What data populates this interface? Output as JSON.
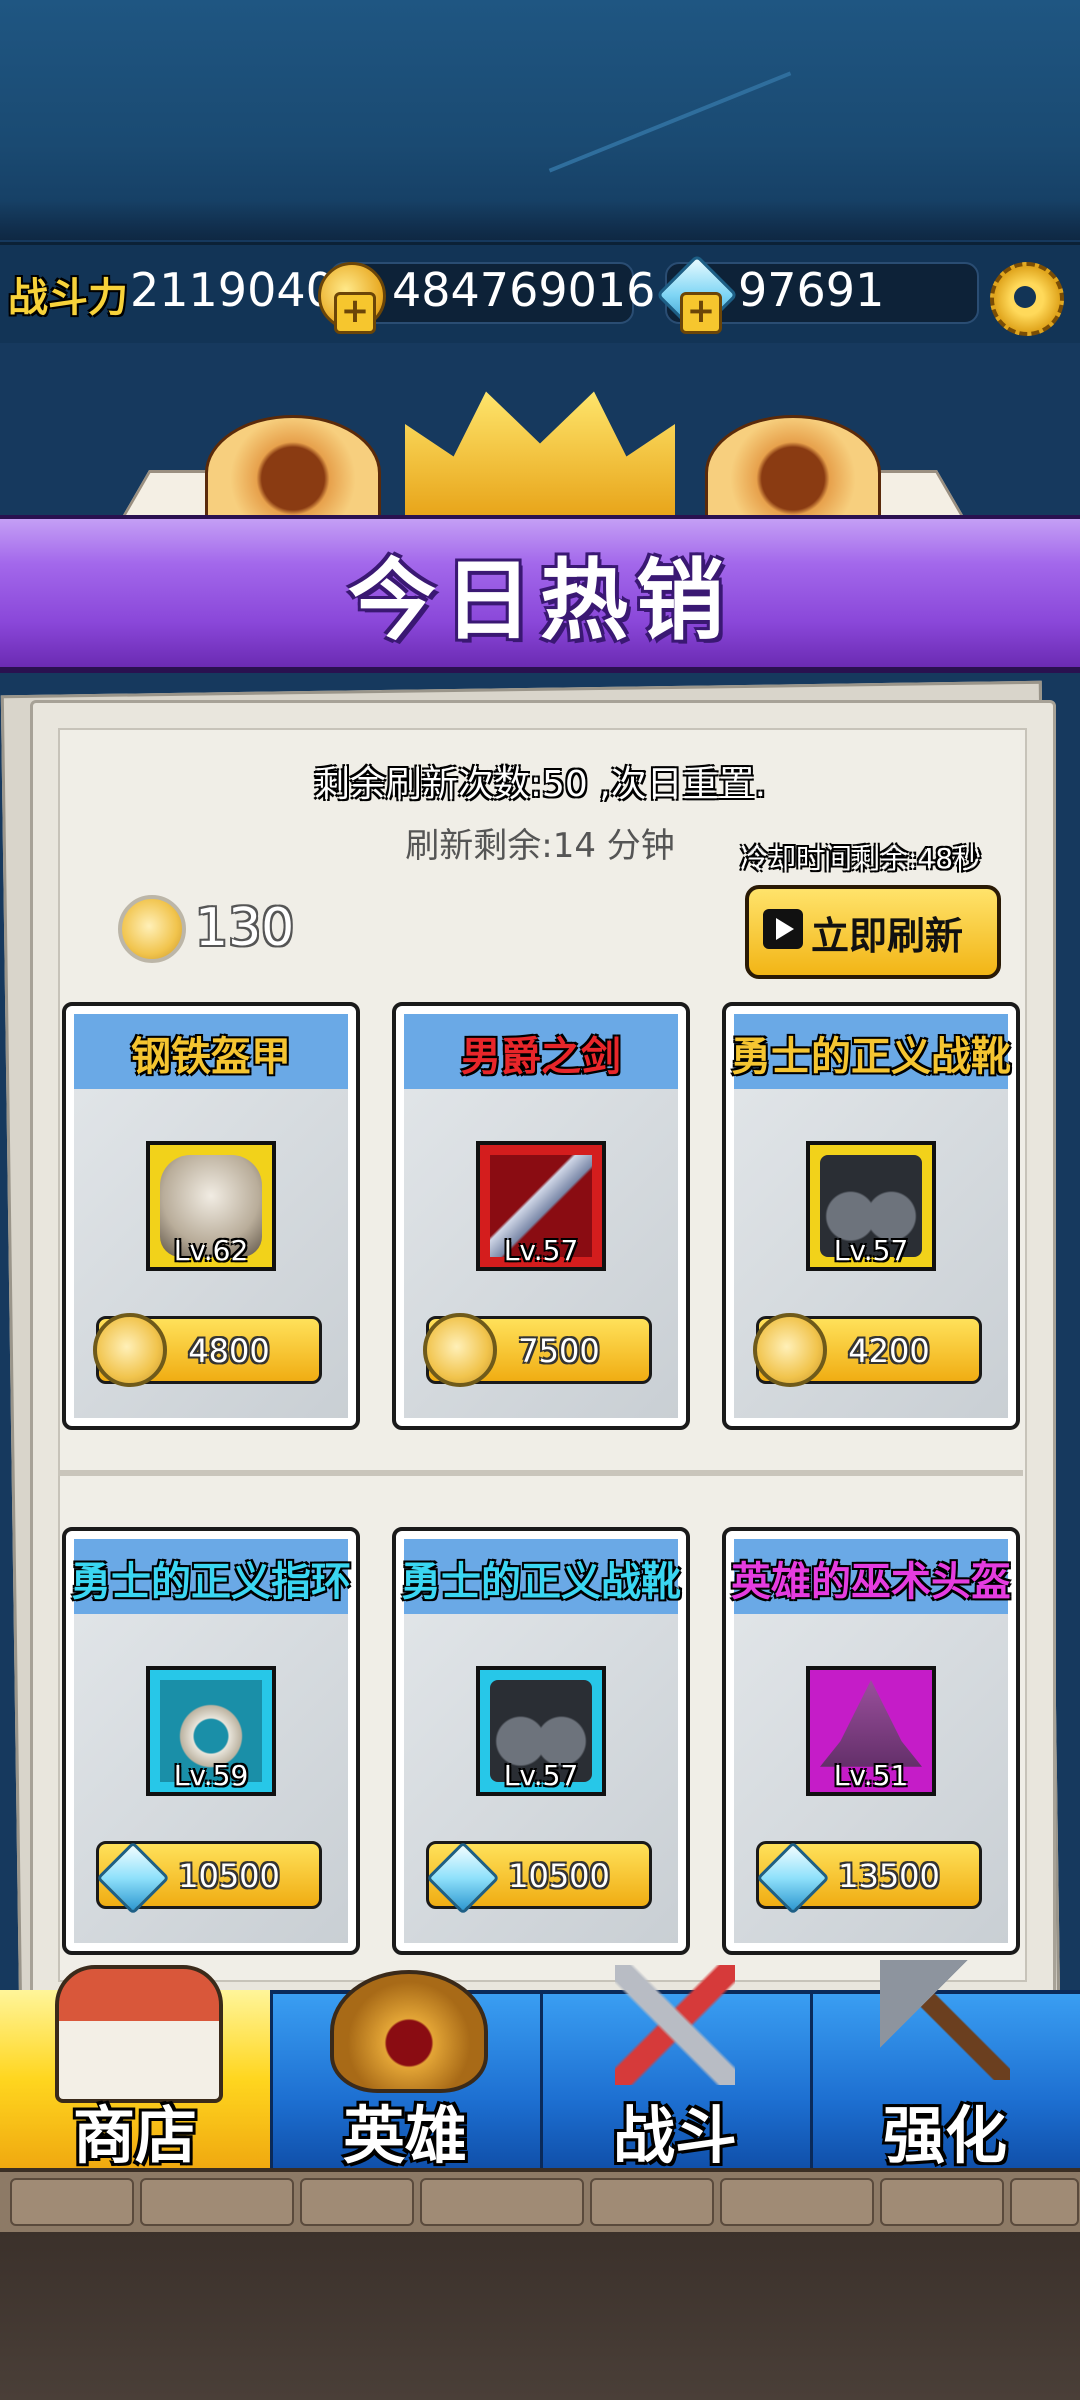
{
  "resources": {
    "power_label": "战斗力",
    "power_value": "2119040",
    "gold_value": "484769016",
    "gem_value": "97691"
  },
  "banner": {
    "title": "今日热销"
  },
  "shop": {
    "refresh_count_text": "剩余刷新次数:50 ,次日重置.",
    "refresh_timer_text": "刷新剩余:14 分钟",
    "cooldown_text": "冷却时间剩余:48秒",
    "coin_count": "130",
    "refresh_button_label": "立即刷新"
  },
  "items": [
    {
      "name": "钢铁盔甲",
      "level": "Lv.62",
      "price": "4800",
      "currency": "coin",
      "name_color": "#f5c531",
      "frame_color": "#f2d21a",
      "icon": "armor-icon"
    },
    {
      "name": "男爵之剑",
      "level": "Lv.57",
      "price": "7500",
      "currency": "coin",
      "name_color": "#e8262a",
      "frame_color": "#d41d1d",
      "icon": "sword-icon"
    },
    {
      "name": "勇士的正义战靴",
      "level": "Lv.57",
      "price": "4200",
      "currency": "coin",
      "name_color": "#f5c531",
      "frame_color": "#f2d21a",
      "icon": "boots-icon"
    },
    {
      "name": "勇士的正义指环",
      "level": "Lv.59",
      "price": "10500",
      "currency": "gem",
      "name_color": "#3ad6f2",
      "frame_color": "#27c7e8",
      "icon": "ring-icon"
    },
    {
      "name": "勇士的正义战靴",
      "level": "Lv.57",
      "price": "10500",
      "currency": "gem",
      "name_color": "#3ad6f2",
      "frame_color": "#27c7e8",
      "icon": "boots-icon"
    },
    {
      "name": "英雄的巫术头盔",
      "level": "Lv.51",
      "price": "13500",
      "currency": "gem",
      "name_color": "#e53ce0",
      "frame_color": "#c51cc8",
      "icon": "wizard-hat-icon"
    }
  ],
  "nav": [
    {
      "label": "商店",
      "icon": "shop-icon",
      "active": true
    },
    {
      "label": "英雄",
      "icon": "helmet-icon",
      "active": false
    },
    {
      "label": "战斗",
      "icon": "crossed-swords-icon",
      "active": false
    },
    {
      "label": "强化",
      "icon": "hammer-icon",
      "active": false
    }
  ]
}
